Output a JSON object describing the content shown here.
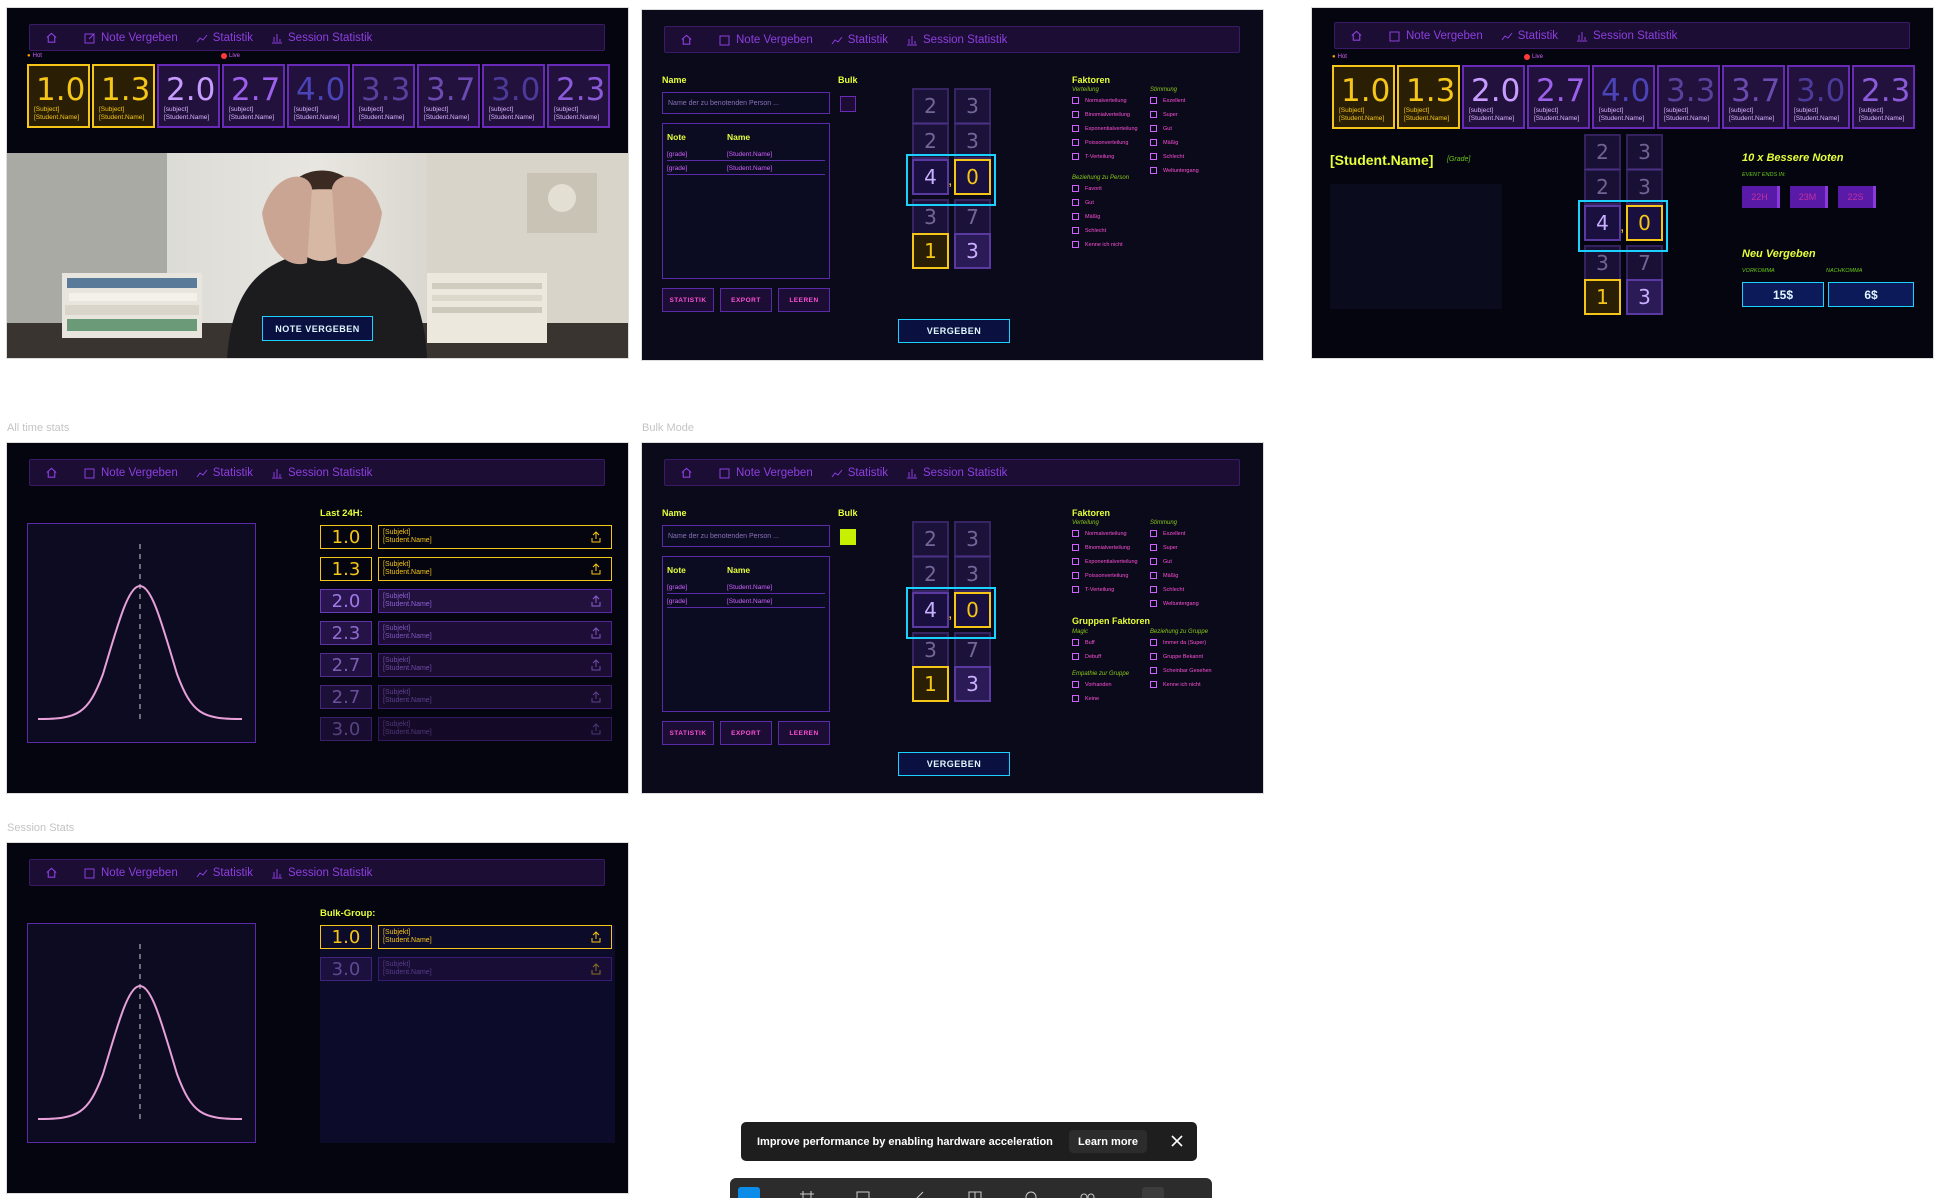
{
  "nav": {
    "home": "home-icon",
    "items": [
      "Note Vergeben",
      "Statistik",
      "Session Statistik"
    ]
  },
  "frame_labels": {
    "all_time": "All time stats",
    "bulk": "Bulk Mode",
    "session": "Session Stats"
  },
  "tiles": [
    {
      "grade": "1.0",
      "subject": "[Subject]",
      "name": "[Student.Name]"
    },
    {
      "grade": "1.3",
      "subject": "[Subject]",
      "name": "[Student.Name]"
    },
    {
      "grade": "2.0",
      "subject": "[subject]",
      "name": "[Student.Name]"
    },
    {
      "grade": "2.7",
      "subject": "[subject]",
      "name": "[Student.Name]"
    },
    {
      "grade": "4.0",
      "subject": "[subject]",
      "name": "[Student.Name]"
    },
    {
      "grade": "3.3",
      "subject": "[subject]",
      "name": "[Student.Name]"
    },
    {
      "grade": "3.7",
      "subject": "[subject]",
      "name": "[Student.Name]"
    },
    {
      "grade": "3.0",
      "subject": "[subject]",
      "name": "[Student.Name]"
    },
    {
      "grade": "2.3",
      "subject": "[subject]",
      "name": "[Student.Name]"
    }
  ],
  "flags": {
    "hot": "Hot",
    "live": "Live"
  },
  "home_cta": "NOTE VERGEBEN",
  "form": {
    "name_label": "Name",
    "bulk_label": "Bulk",
    "name_placeholder": "Name der zu benotenden Person ...",
    "col_note": "Note",
    "col_name": "Name",
    "rows": [
      {
        "grade": "[grade]",
        "name": "[Student.Name]"
      },
      {
        "grade": "[grade]",
        "name": "[Student.Name]"
      }
    ],
    "buttons": [
      "STATISTIK",
      "EXPORT",
      "LEEREN"
    ],
    "submit": "VERGEBEN"
  },
  "picker": {
    "left": [
      "2",
      "2",
      "4",
      "3",
      "1"
    ],
    "right": [
      "3",
      "3",
      "0",
      "7",
      "3"
    ],
    "comma": ","
  },
  "factors": {
    "title": "Faktoren",
    "verteilung_label": "Verteilung",
    "verteilung": [
      "Normalverteilung",
      "Binomialverteilung",
      "Exponentialverteilung",
      "Poissonverteilung",
      "T-Verteilung"
    ],
    "stimmung_label": "Stimmung",
    "stimmung": [
      "Exzellent",
      "Super",
      "Gut",
      "Mäßig",
      "Schlecht",
      "Weltuntergang"
    ],
    "beziehung_label": "Beziehung zu Person",
    "beziehung": [
      "Favorit",
      "Gut",
      "Mäßig",
      "Schlecht",
      "Kenne ich nicht"
    ]
  },
  "group_factors": {
    "title": "Gruppen Faktoren",
    "mogic_label": "Magic",
    "mogic": [
      "Buff",
      "Debuff"
    ],
    "empathie_label": "Empathie zur Gruppe",
    "empathie": [
      "Vorhanden",
      "Keine"
    ],
    "gruppe_label": "Beziehung zu Gruppe",
    "gruppe": [
      "Immer da (Super)",
      "Gruppe Bekannt",
      "Scheinbar Gesehen",
      "Kenne ich nicht"
    ]
  },
  "student_view": {
    "name": "[Student.Name]",
    "grade_tag": "[Grade]",
    "better_title": "10 x Bessere Noten",
    "event_ends": "EVENT ENDS IN:",
    "timer": [
      "22H",
      "23M",
      "22S"
    ],
    "new_title": "Neu Vergeben",
    "vorkomma": "VORKOMMA",
    "nachkomma": "NACHKOMMA",
    "price_pre": "15$",
    "price_post": "6$"
  },
  "stats": {
    "last24_title": "Last 24H:",
    "items": [
      {
        "grade": "1.0",
        "subject": "[Subjekt]",
        "name": "[Student.Name]"
      },
      {
        "grade": "1.3",
        "subject": "[Subjekt]",
        "name": "[Student.Name]"
      },
      {
        "grade": "2.0",
        "subject": "[Subjekt]",
        "name": "[Student.Name]"
      },
      {
        "grade": "2.3",
        "subject": "[Subjekt]",
        "name": "[Student.Name]"
      },
      {
        "grade": "2.7",
        "subject": "[Subjekt]",
        "name": "[Student.Name]"
      },
      {
        "grade": "2.7",
        "subject": "[Subjekt]",
        "name": "[Student.Name]"
      },
      {
        "grade": "3.0",
        "subject": "[Subjekt]",
        "name": "[Student.Name]"
      }
    ],
    "bulk_group_title": "Bulk-Group:",
    "bulk_items": [
      {
        "grade": "1.0",
        "subject": "[Subjekt]",
        "name": "[Student.Name]"
      },
      {
        "grade": "3.0",
        "subject": "[Subjekt]",
        "name": "[Student.Name]"
      }
    ]
  },
  "toast": {
    "message": "Improve performance by enabling hardware acceleration",
    "learn_more": "Learn more"
  },
  "colors": {
    "accent_yellow": "#f5c518",
    "neon_lime": "#e6ff3a",
    "cyan": "#1ad1ff",
    "purple": "#8e3fe0",
    "pink": "#ff4fd8"
  }
}
